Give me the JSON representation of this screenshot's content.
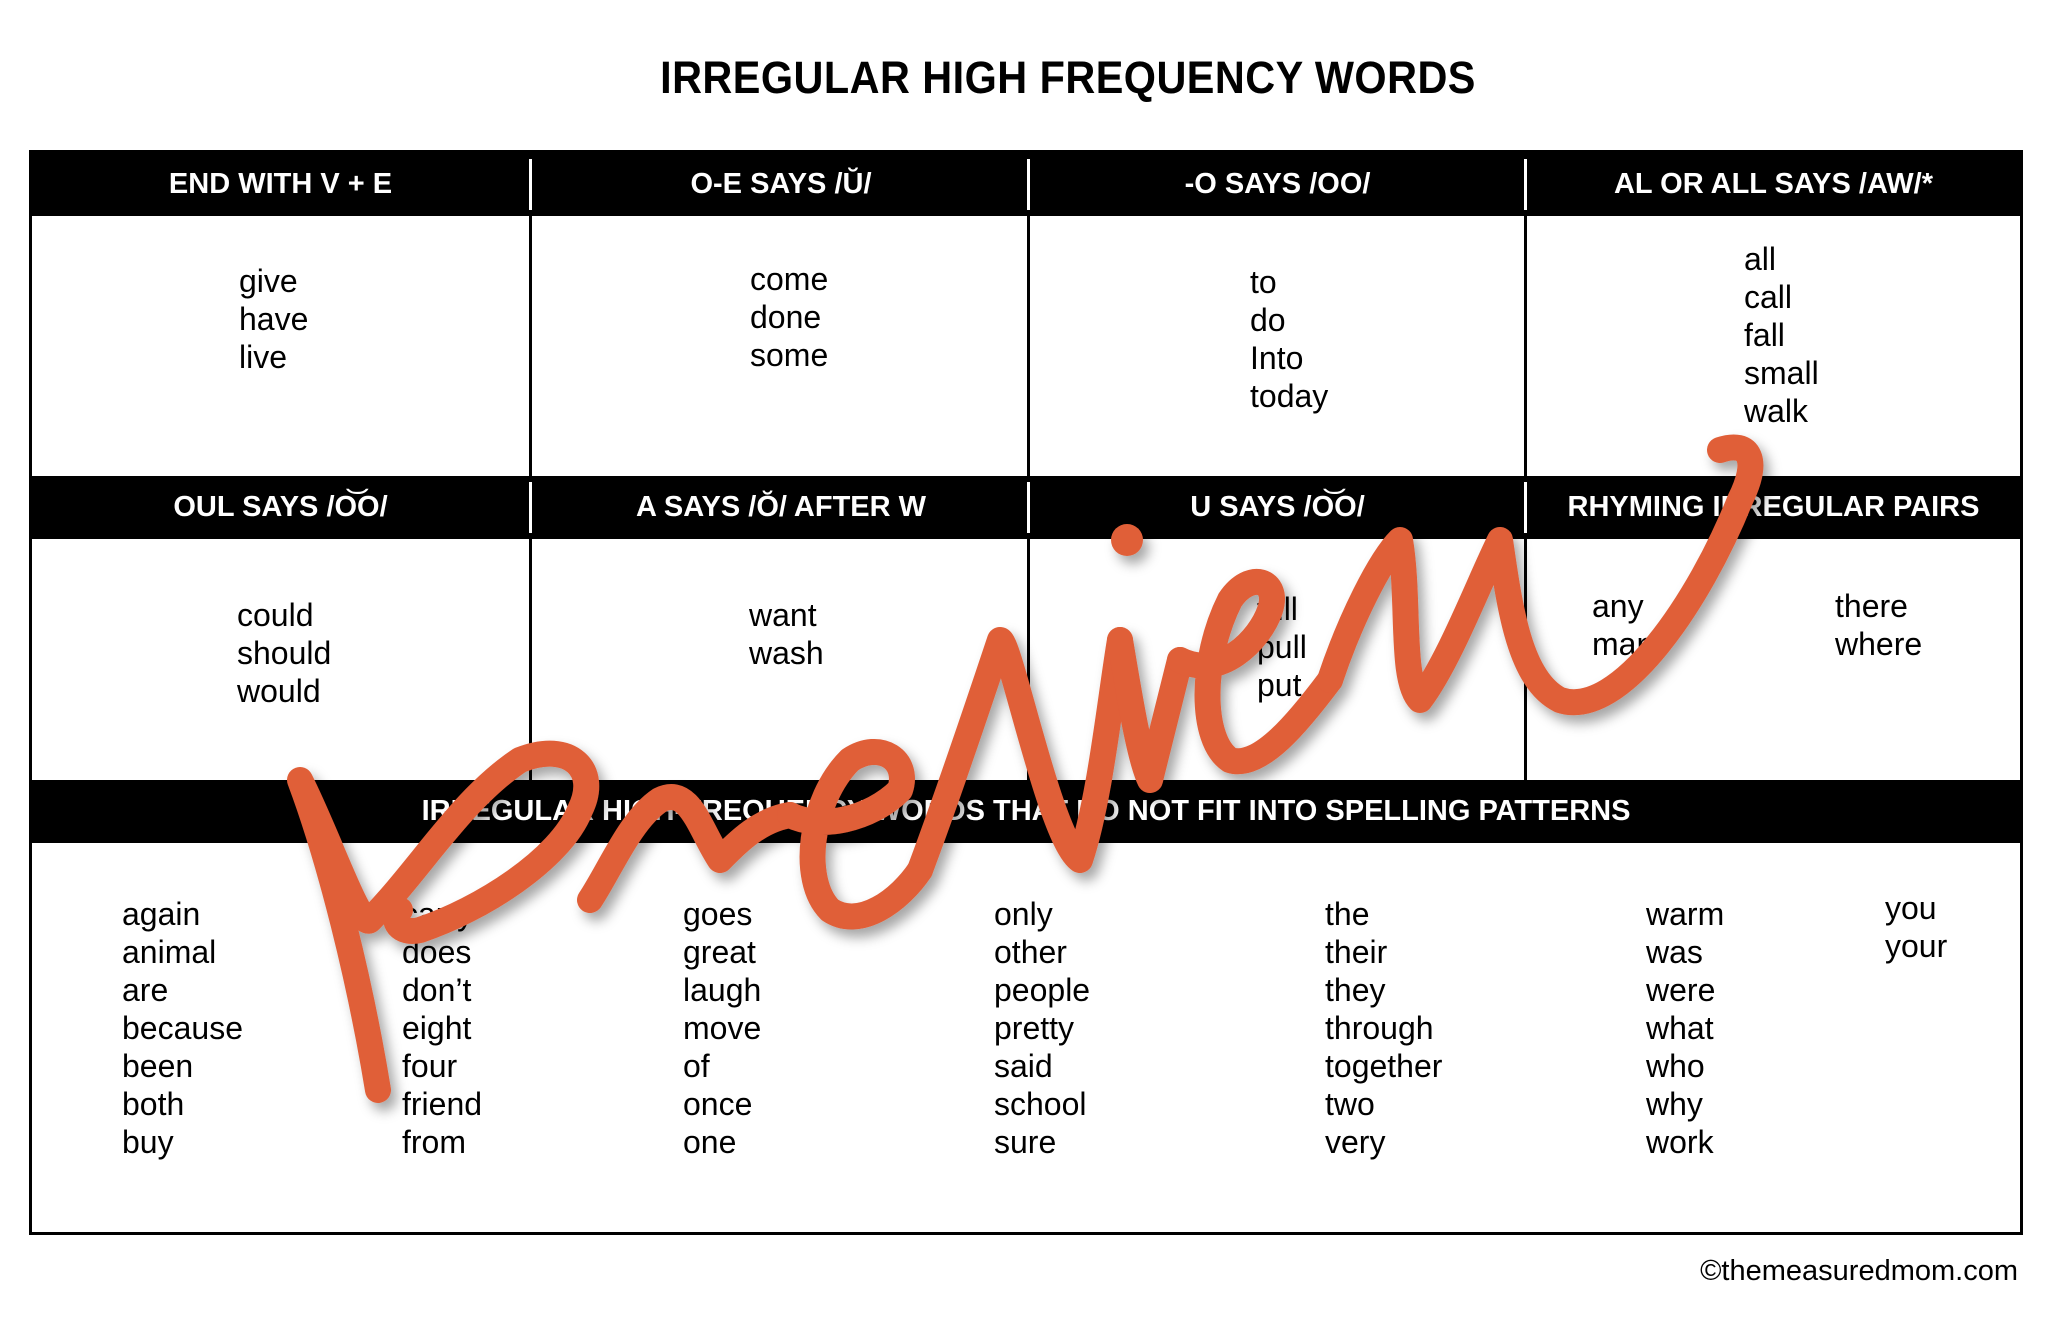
{
  "title": "IRREGULAR HIGH FREQUENCY WORDS",
  "row1": {
    "headers": [
      "END WITH V + E",
      "O-E SAYS /Ŭ/",
      "-O SAYS /OO/",
      "AL OR ALL SAYS /AW/*"
    ],
    "cells": [
      [
        "give",
        "have",
        "live"
      ],
      [
        "come",
        "done",
        "some"
      ],
      [
        "to",
        "do",
        "Into",
        "today"
      ],
      [
        "all",
        "call",
        "fall",
        "small",
        "walk"
      ]
    ]
  },
  "row2": {
    "headers": [
      "OUL SAYS /O͝O/",
      "A SAYS /Ŏ/ AFTER W",
      "U SAYS /O͝O/",
      "RHYMING IRREGULAR PAIRS"
    ],
    "cells": [
      [
        "could",
        "should",
        "would"
      ],
      [
        "want",
        "wash"
      ],
      [
        "full",
        "pull",
        "put"
      ],
      [
        "any",
        "many"
      ]
    ],
    "rhyming_pair_2": [
      "there",
      "where"
    ]
  },
  "row3": {
    "header": "IRREGULAR HIGH-FREQUENCY WORDS THAT DO NOT FIT INTO SPELLING PATTERNS",
    "columns": [
      [
        "again",
        "animal",
        "are",
        "because",
        "been",
        "both",
        "buy"
      ],
      [
        "carry",
        "does",
        "don’t",
        "eight",
        "four",
        "friend",
        "from"
      ],
      [
        "goes",
        "great",
        "laugh",
        "move",
        "of",
        "once",
        "one"
      ],
      [
        "only",
        "other",
        "people",
        "pretty",
        "said",
        "school",
        "sure"
      ],
      [
        "the",
        "their",
        "they",
        "through",
        "together",
        "two",
        "very"
      ],
      [
        "warm",
        "was",
        "were",
        "what",
        "who",
        "why",
        "work"
      ],
      [
        "you",
        "your"
      ]
    ]
  },
  "footer": "©themeasuredmom.com",
  "watermark": {
    "text": "preview",
    "color": "#E05E38"
  }
}
